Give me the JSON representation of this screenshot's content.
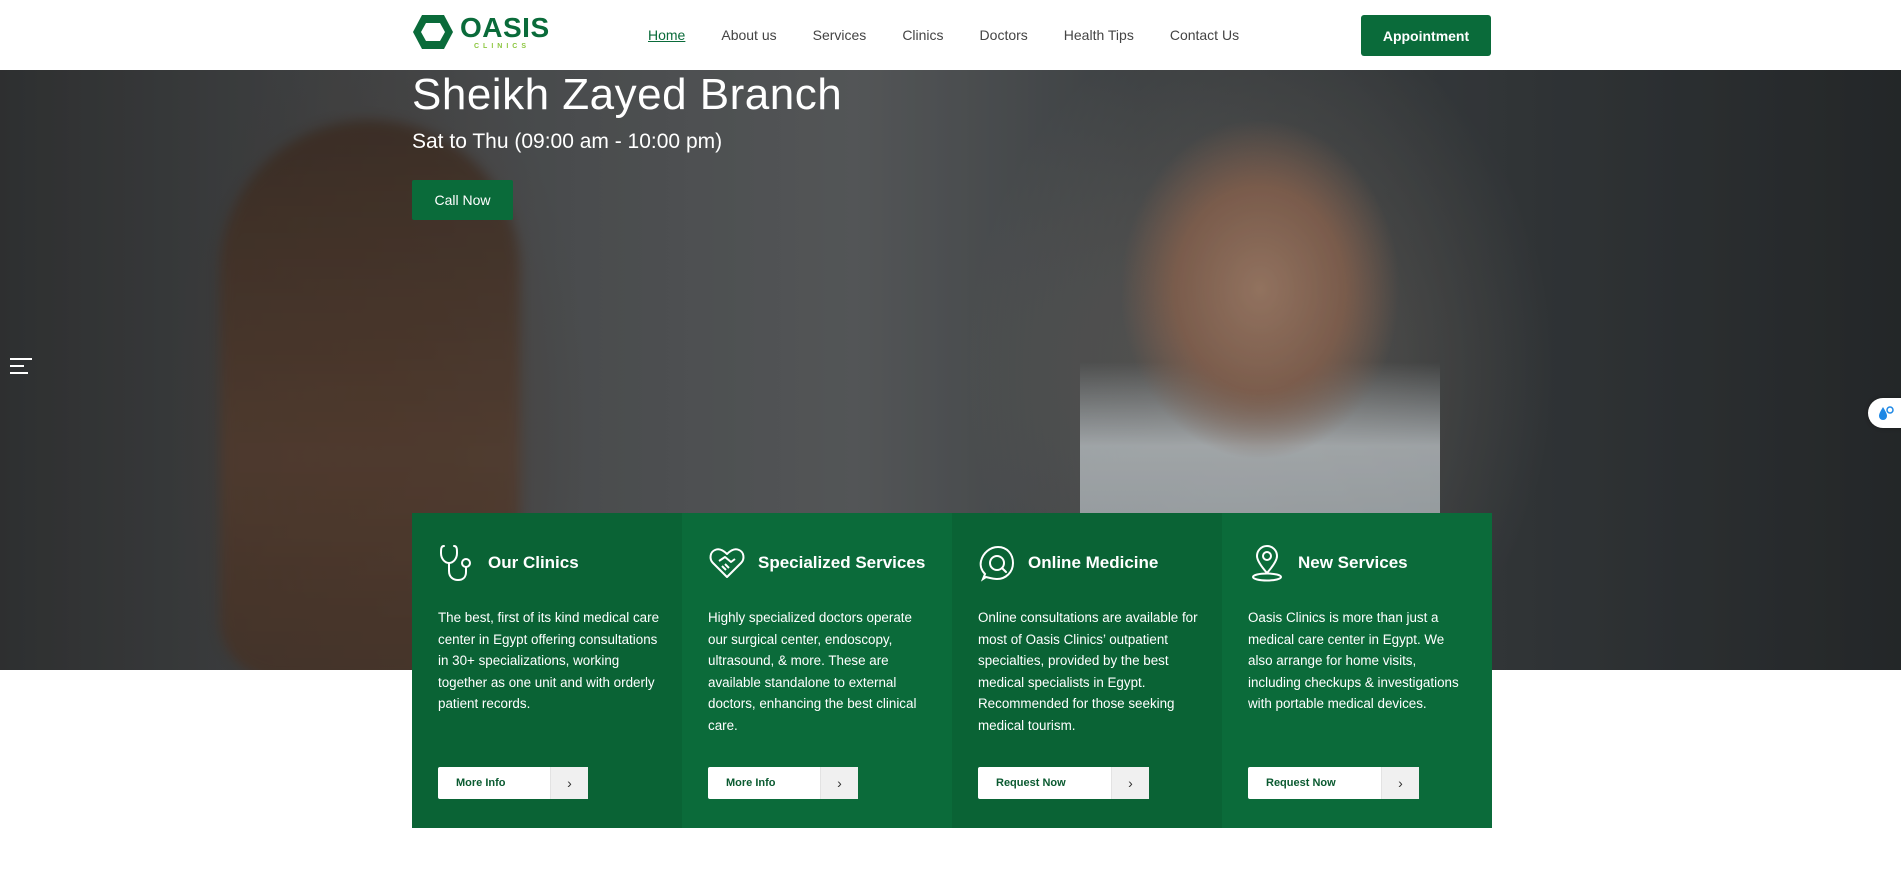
{
  "header": {
    "logo": {
      "word": "OASIS",
      "sub": "CLINICS"
    },
    "nav": [
      {
        "label": "Home",
        "active": true
      },
      {
        "label": "About us"
      },
      {
        "label": "Services"
      },
      {
        "label": "Clinics"
      },
      {
        "label": "Doctors"
      },
      {
        "label": "Health Tips"
      },
      {
        "label": "Contact Us"
      }
    ],
    "appointment_label": "Appointment"
  },
  "hero": {
    "title": "Sheikh Zayed Branch",
    "hours": "Sat to Thu (09:00 am - 10:00 pm)",
    "call_label": "Call Now"
  },
  "cards": [
    {
      "icon": "stethoscope-icon",
      "title": "Our Clinics",
      "text": "The best, first of its kind medical care center in Egypt offering consultations in 30+ specializations, working together as one unit and with orderly patient records.",
      "button": "More Info"
    },
    {
      "icon": "heart-handshake-icon",
      "title": "Specialized Services",
      "text": "Highly specialized doctors operate our surgical center, endoscopy, ultrasound, & more. These are available standalone to external doctors, enhancing the best clinical care.",
      "button": "More Info"
    },
    {
      "icon": "online-medicine-icon",
      "title": "Online Medicine",
      "text": "Online consultations are available for most of Oasis Clinics’ outpatient specialties, provided by the best medical specialists in Egypt. Recommended for those seeking medical tourism.",
      "button": "Request Now"
    },
    {
      "icon": "location-pin-icon",
      "title": "New Services",
      "text": "Oasis Clinics is more than just a medical care center in Egypt. We also arrange for home visits, including checkups & investigations with portable medical devices.",
      "button": "Request Now"
    }
  ],
  "colors": {
    "brand_green": "#0a6b3a",
    "accent_lime": "#8cc63f"
  }
}
